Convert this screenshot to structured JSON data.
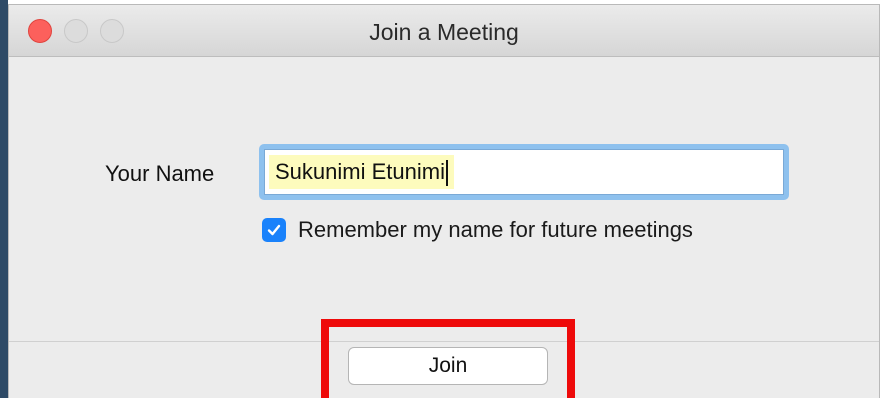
{
  "window": {
    "title": "Join a Meeting"
  },
  "form": {
    "name_label": "Your Name",
    "name_value": "Sukunimi Etunimi",
    "remember_label": "Remember my name for future meetings",
    "remember_checked": true
  },
  "footer": {
    "join_label": "Join"
  },
  "colors": {
    "close_button": "#fc605c",
    "checkbox": "#1a82fb",
    "focus_ring": "#8ec1ee",
    "autofill_highlight": "#fdfbbd",
    "annotation_box": "#ee0a0a"
  }
}
